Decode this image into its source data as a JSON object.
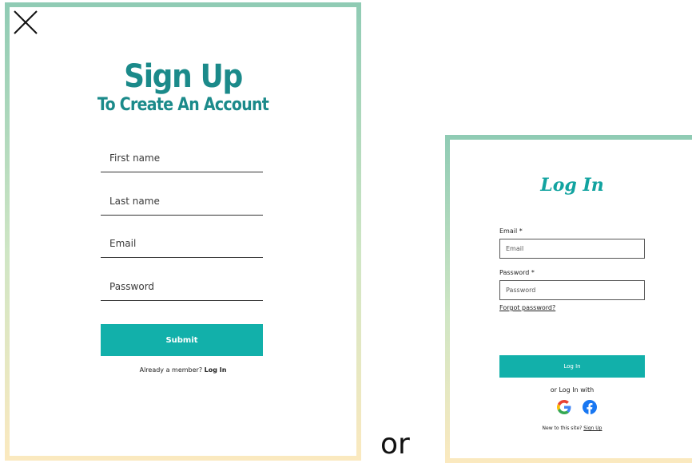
{
  "signup": {
    "title": "Sign Up",
    "subtitle": "To Create An Account",
    "fields": {
      "first_name": "First name",
      "last_name": "Last name",
      "email": "Email",
      "password": "Password"
    },
    "submit_label": "Submit",
    "member_prompt": "Already a member?",
    "login_link": "Log In"
  },
  "separator": "or",
  "login": {
    "title": "Log In",
    "email_label": "Email *",
    "email_placeholder": "Email",
    "password_label": "Password *",
    "password_placeholder": "Password",
    "forgot_link": "Forgot password?",
    "button_label": "Log In",
    "social_prompt": "or Log In with",
    "new_prompt": "New to this site?",
    "signup_link": "Sign Up"
  },
  "icons": {
    "close": "close-icon",
    "google": "google-icon",
    "facebook": "facebook-icon"
  },
  "colors": {
    "brand_teal": "#12b0aa",
    "title_teal": "#1b8a8a",
    "border_top": "#8fcbb4",
    "border_bottom": "#fbe9bf",
    "facebook_blue": "#1877f2"
  }
}
